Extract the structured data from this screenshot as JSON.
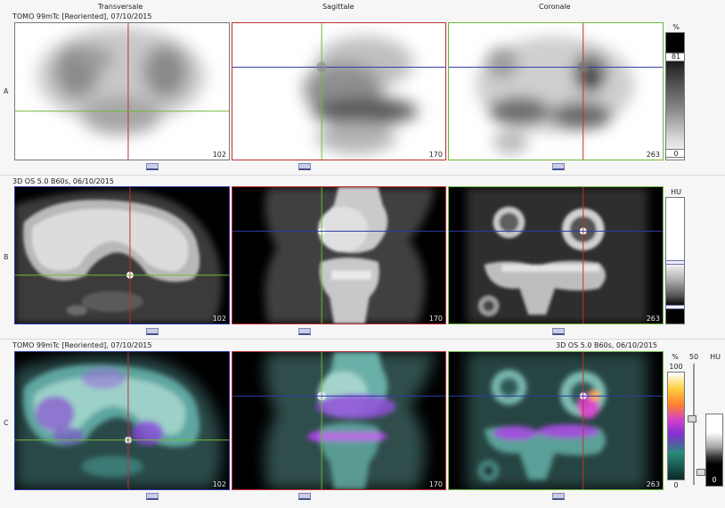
{
  "headers": {
    "transversale": "Transversale",
    "sagittale": "Sagittale",
    "coronale": "Coronale"
  },
  "rows": {
    "a": {
      "label": "A",
      "title": "TOMO 99mTc [Reoriented], 07/10/2015"
    },
    "b": {
      "label": "B",
      "title": "3D  OS  5.0  B60s, 06/10/2015"
    },
    "c": {
      "label": "C",
      "title_left": "TOMO 99mTc [Reoriented], 07/10/2015",
      "title_right": "3D  OS  5.0  B60s, 06/10/2015"
    }
  },
  "slices": {
    "transversale": "102",
    "sagittale": "170",
    "coronale": "263"
  },
  "colorbars": {
    "spect": {
      "unit": "%",
      "max": "81",
      "min": "0"
    },
    "ct": {
      "unit": "HU"
    },
    "fusion_pct": {
      "unit": "%",
      "max": "100",
      "min": "0"
    },
    "fusion_mid": {
      "value": "50"
    },
    "fusion_hu": {
      "unit": "HU",
      "min": "0"
    }
  },
  "colors": {
    "crosshair_red": "#c03030",
    "crosshair_green": "#72b83c",
    "crosshair_blue": "#2f3aa8"
  }
}
